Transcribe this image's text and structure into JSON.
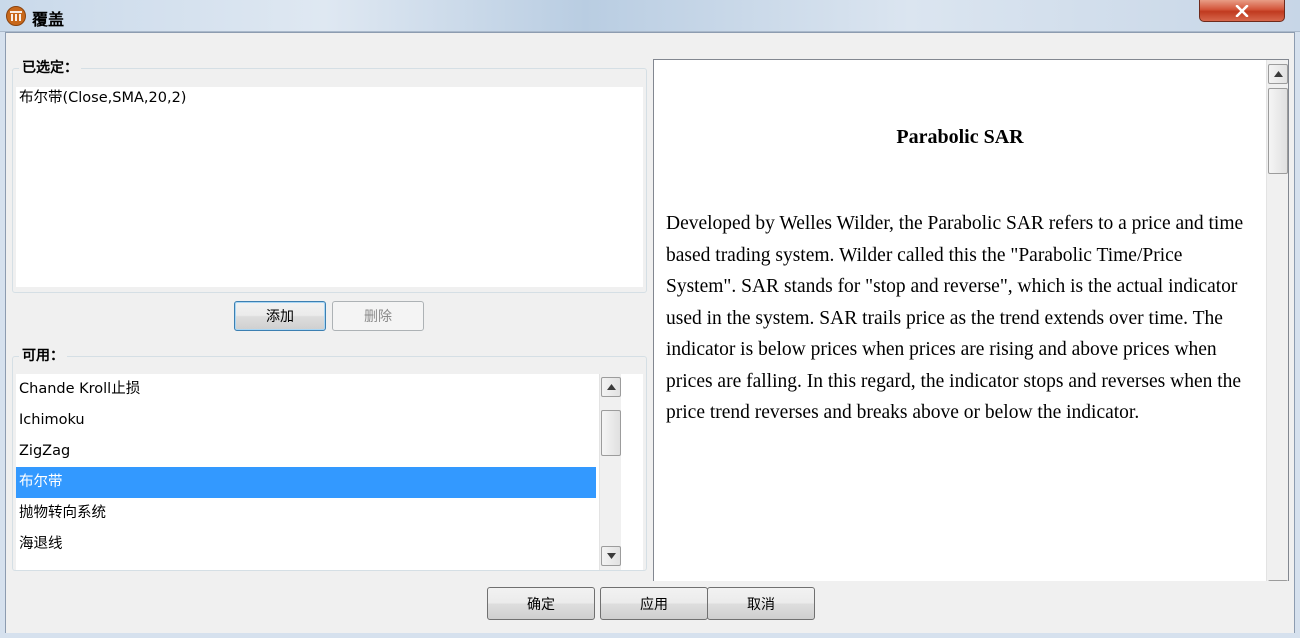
{
  "window": {
    "title": "覆盖",
    "app_icon": "metatrader-logo-icon",
    "close_icon": "close-icon"
  },
  "selected": {
    "legend": "已选定：",
    "items": [
      "布尔带(Close,SMA,20,2)"
    ]
  },
  "actions": {
    "add_label": "添加",
    "delete_label": "删除"
  },
  "available": {
    "legend": "可用：",
    "items": [
      {
        "label": "Chande Kroll止损",
        "selected": false
      },
      {
        "label": "Ichimoku",
        "selected": false
      },
      {
        "label": "ZigZag",
        "selected": false
      },
      {
        "label": "布尔带",
        "selected": true
      },
      {
        "label": "抛物转向系统",
        "selected": false
      },
      {
        "label": "海退线",
        "selected": false
      }
    ]
  },
  "info": {
    "title": "Parabolic SAR",
    "body": "Developed by Welles Wilder, the Parabolic SAR refers to a price and time based trading system. Wilder called this the \"Parabolic Time/Price System\". SAR stands for \"stop and reverse\", which is the actual indicator used in the system. SAR trails price as the trend extends over time. The indicator is below prices when prices are rising and above prices when prices are falling. In this regard, the indicator stops and reverses when the price trend reverses and breaks above or below the indicator."
  },
  "footer": {
    "ok_label": "确定",
    "apply_label": "应用",
    "cancel_label": "取消"
  },
  "colors": {
    "selection": "#3399ff",
    "close_button": "#c9452a"
  }
}
